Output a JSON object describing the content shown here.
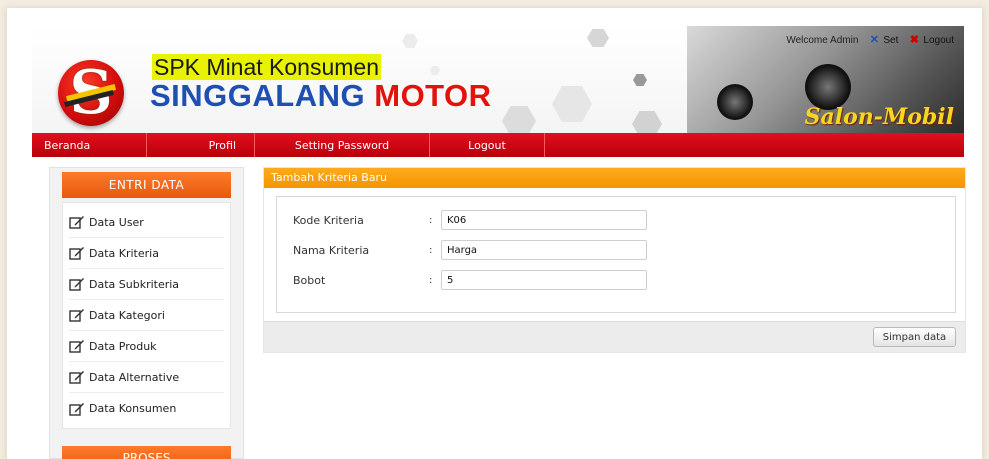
{
  "brand": {
    "line1": "SPK Minat Konsumen",
    "line2_a": "SINGGALANG",
    "line2_b": "MOTOR",
    "logo_letter": "S",
    "salon_text": "Salon-Mobil"
  },
  "topbar": {
    "welcome": "Welcome Admin",
    "settings": "Set",
    "logout": "Logout"
  },
  "nav": {
    "items": [
      {
        "label": "Beranda"
      },
      {
        "label": "Profil"
      },
      {
        "label": "Setting Password"
      },
      {
        "label": "Logout"
      }
    ]
  },
  "sidebar": {
    "section1": "ENTRI DATA",
    "items": [
      {
        "label": "Data User"
      },
      {
        "label": "Data Kriteria"
      },
      {
        "label": "Data Subkriteria"
      },
      {
        "label": "Data Kategori"
      },
      {
        "label": "Data Produk"
      },
      {
        "label": "Data Alternative"
      },
      {
        "label": "Data Konsumen"
      }
    ],
    "section2": "PROSES"
  },
  "form": {
    "title": "Tambah Kriteria Baru",
    "fields": [
      {
        "label": "Kode Kriteria",
        "value": "K06"
      },
      {
        "label": "Nama Kriteria",
        "value": "Harga"
      },
      {
        "label": "Bobot",
        "value": "5"
      }
    ],
    "separator": ":",
    "save_label": "Simpan data"
  },
  "colors": {
    "nav_red": "#d4000f",
    "sidebar_orange": "#e8601a",
    "panel_orange": "#f7a000",
    "brand_blue": "#1f4fb3",
    "brand_red": "#e3120b",
    "highlight_yellow": "#e9f200"
  },
  "icons": {
    "sidebar_item": "edit-icon",
    "topbar_settings": "settings-icon",
    "topbar_logout": "logout-icon"
  }
}
